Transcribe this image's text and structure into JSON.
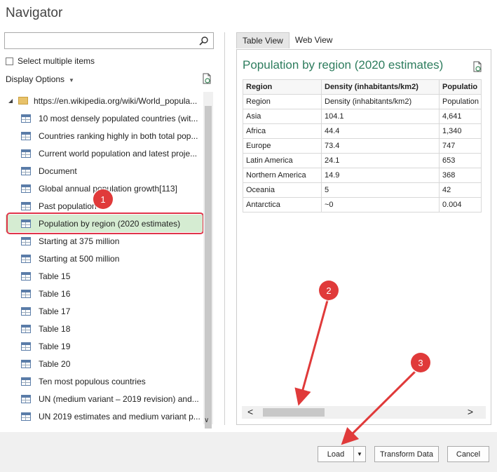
{
  "window": {
    "title": "Navigator"
  },
  "search": {
    "placeholder": ""
  },
  "select_multiple": {
    "label": "Select multiple items"
  },
  "display_options": {
    "label": "Display Options"
  },
  "tree": {
    "root": "https://en.wikipedia.org/wiki/World_popula...",
    "items": [
      {
        "label": "10 most densely populated countries (wit...",
        "selected": false
      },
      {
        "label": "Countries ranking highly in both total pop...",
        "selected": false
      },
      {
        "label": "Current world population and latest proje...",
        "selected": false
      },
      {
        "label": "Document",
        "selected": false
      },
      {
        "label": "Global annual population growth[113]",
        "selected": false
      },
      {
        "label": "Past population",
        "selected": false
      },
      {
        "label": "Population by region (2020 estimates)",
        "selected": true
      },
      {
        "label": "Starting at 375 million",
        "selected": false
      },
      {
        "label": "Starting at 500 million",
        "selected": false
      },
      {
        "label": "Table 15",
        "selected": false
      },
      {
        "label": "Table 16",
        "selected": false
      },
      {
        "label": "Table 17",
        "selected": false
      },
      {
        "label": "Table 18",
        "selected": false
      },
      {
        "label": "Table 19",
        "selected": false
      },
      {
        "label": "Table 20",
        "selected": false
      },
      {
        "label": "Ten most populous countries",
        "selected": false
      },
      {
        "label": "UN (medium variant – 2019 revision) and...",
        "selected": false
      },
      {
        "label": "UN 2019 estimates and medium variant p...",
        "selected": false
      }
    ]
  },
  "tabs": [
    {
      "label": "Table View",
      "active": true
    },
    {
      "label": "Web View",
      "active": false
    }
  ],
  "preview": {
    "title": "Population by region (2020 estimates)",
    "columns": [
      "Region",
      "Density (inhabitants/km2)",
      "Populatio"
    ],
    "rows": [
      [
        "Region",
        "Density (inhabitants/km2)",
        "Population"
      ],
      [
        "Asia",
        "104.1",
        "4,641"
      ],
      [
        "Africa",
        "44.4",
        "1,340"
      ],
      [
        "Europe",
        "73.4",
        "747"
      ],
      [
        "Latin America",
        "24.1",
        "653"
      ],
      [
        "Northern America",
        "14.9",
        "368"
      ],
      [
        "Oceania",
        "5",
        "42"
      ],
      [
        "Antarctica",
        "~0",
        "0.004"
      ]
    ]
  },
  "buttons": {
    "load": "Load",
    "transform": "Transform Data",
    "cancel": "Cancel"
  },
  "annotations": [
    "1",
    "2",
    "3"
  ],
  "colors": {
    "annotation": "#e03a3a",
    "selected_row": "#d5ecd2",
    "title_green": "#2e7d5e"
  }
}
